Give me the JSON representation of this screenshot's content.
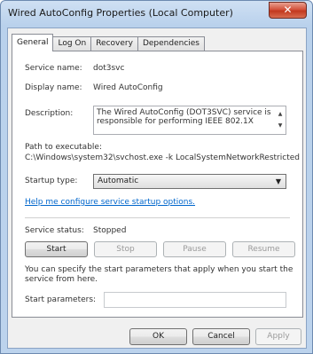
{
  "window": {
    "title": "Wired AutoConfig Properties (Local Computer)",
    "close_glyph": "✕"
  },
  "tabs": [
    {
      "label": "General",
      "active": true
    },
    {
      "label": "Log On",
      "active": false
    },
    {
      "label": "Recovery",
      "active": false
    },
    {
      "label": "Dependencies",
      "active": false
    }
  ],
  "general": {
    "service_name_label": "Service name:",
    "service_name": "dot3svc",
    "display_name_label": "Display name:",
    "display_name": "Wired AutoConfig",
    "description_label": "Description:",
    "description": "The Wired AutoConfig (DOT3SVC) service is responsible for performing IEEE 802.1X",
    "path_label": "Path to executable:",
    "path": "C:\\Windows\\system32\\svchost.exe -k LocalSystemNetworkRestricted",
    "startup_type_label": "Startup type:",
    "startup_type": "Automatic",
    "help_link": "Help me configure service startup options.",
    "service_status_label": "Service status:",
    "service_status": "Stopped",
    "buttons": {
      "start": "Start",
      "stop": "Stop",
      "pause": "Pause",
      "resume": "Resume"
    },
    "params_info": "You can specify the start parameters that apply when you start the service from here.",
    "start_params_label": "Start parameters:",
    "start_params_value": ""
  },
  "footer": {
    "ok": "OK",
    "cancel": "Cancel",
    "apply": "Apply"
  },
  "icons": {
    "scroll_up": "▲",
    "scroll_down": "▼",
    "dropdown": "▼"
  }
}
